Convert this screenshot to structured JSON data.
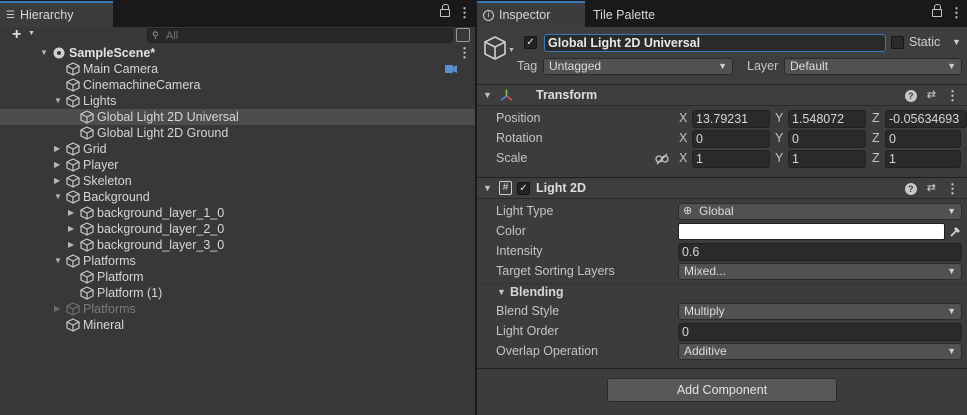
{
  "hierarchy": {
    "tab_label": "Hierarchy",
    "search_placeholder": "All",
    "add_label": "+",
    "scene": "SampleScene*",
    "items": [
      {
        "label": "Main Camera"
      },
      {
        "label": "CinemachineCamera"
      },
      {
        "label": "Lights"
      },
      {
        "label": "Global Light 2D Universal"
      },
      {
        "label": "Global Light 2D Ground"
      },
      {
        "label": "Grid"
      },
      {
        "label": "Player"
      },
      {
        "label": "Skeleton"
      },
      {
        "label": "Background"
      },
      {
        "label": "background_layer_1_0"
      },
      {
        "label": "background_layer_2_0"
      },
      {
        "label": "background_layer_3_0"
      },
      {
        "label": "Platforms"
      },
      {
        "label": "Platform"
      },
      {
        "label": "Platform (1)"
      },
      {
        "label": "Platforms"
      },
      {
        "label": "Mineral"
      }
    ]
  },
  "inspector": {
    "tab_label": "Inspector",
    "tab2_label": "Tile Palette",
    "object_name": "Global Light 2D Universal",
    "static_label": "Static",
    "tag_label": "Tag",
    "tag_value": "Untagged",
    "layer_label": "Layer",
    "layer_value": "Default",
    "transform": {
      "title": "Transform",
      "position_label": "Position",
      "rotation_label": "Rotation",
      "scale_label": "Scale",
      "x": "X",
      "y": "Y",
      "z": "Z",
      "position": [
        "13.79231",
        "1.548072",
        "-0.05634693"
      ],
      "rotation": [
        "0",
        "0",
        "0"
      ],
      "scale": [
        "1",
        "1",
        "1"
      ]
    },
    "light2d": {
      "title": "Light 2D",
      "light_type_label": "Light Type",
      "light_type_value": "Global",
      "color_label": "Color",
      "color_value": "#ffffff",
      "intensity_label": "Intensity",
      "intensity_value": "0.6",
      "sorting_label": "Target Sorting Layers",
      "sorting_value": "Mixed...",
      "blending_label": "Blending",
      "blend_style_label": "Blend Style",
      "blend_style_value": "Multiply",
      "light_order_label": "Light Order",
      "light_order_value": "0",
      "overlap_label": "Overlap Operation",
      "overlap_value": "Additive"
    },
    "add_component_label": "Add Component"
  },
  "colors": {
    "accent": "#3a79bb",
    "panel": "#383838",
    "selected_row": "#4d4d4d"
  }
}
